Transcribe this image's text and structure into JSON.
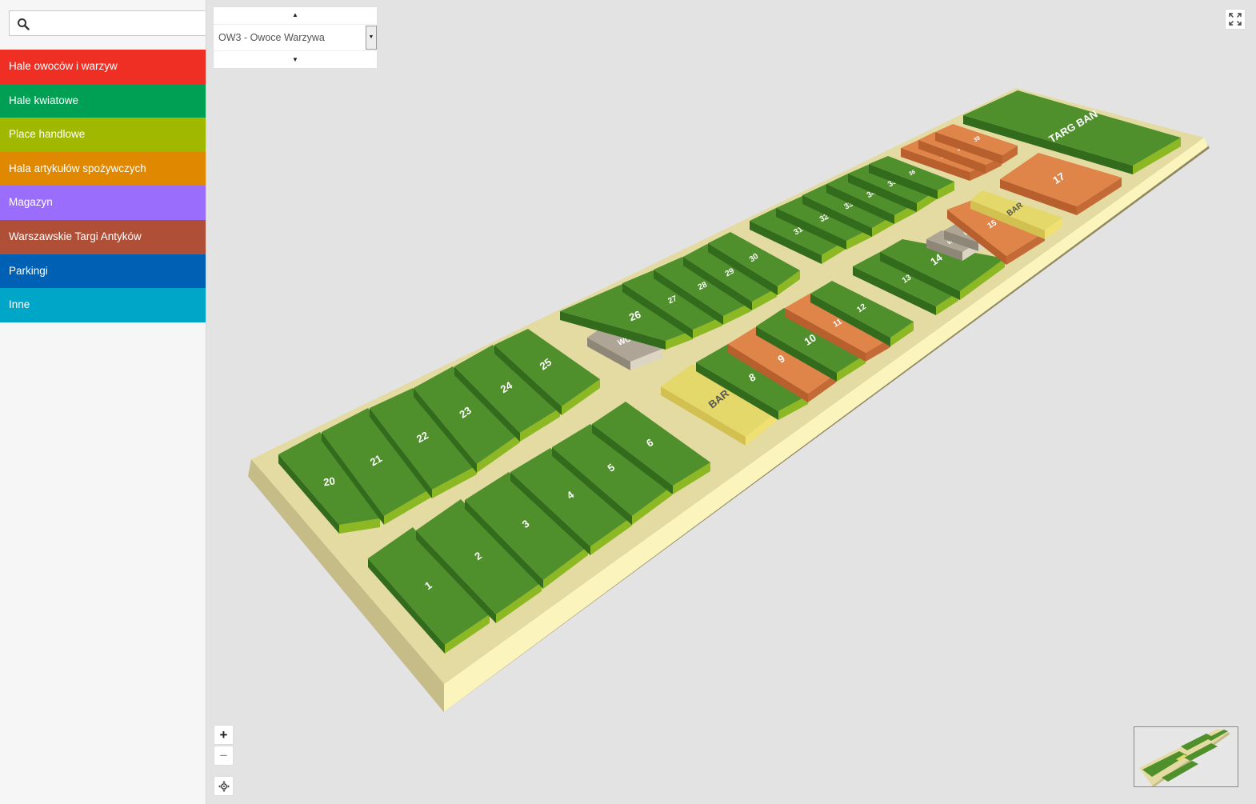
{
  "sidebar": {
    "search": {
      "value": "",
      "placeholder": ""
    },
    "categories": [
      {
        "label": "Hale owoców i warzyw",
        "color": "#ef2e24"
      },
      {
        "label": "Hale kwiatowe",
        "color": "#00a054"
      },
      {
        "label": "Place handlowe",
        "color": "#a0b800"
      },
      {
        "label": "Hala artykułów spożywczych",
        "color": "#e08800"
      },
      {
        "label": "Magazyn",
        "color": "#9b6dfc"
      },
      {
        "label": "Warszawskie Targi Antyków",
        "color": "#b04f38"
      },
      {
        "label": "Parkingi",
        "color": "#0060b4"
      },
      {
        "label": "Inne",
        "color": "#00a6c8"
      }
    ]
  },
  "selector": {
    "value": "OW3 - Owoce Warzywa"
  },
  "controls": {
    "zoom_in": "+",
    "zoom_out": "−"
  },
  "map": {
    "colors": {
      "stall": "#4f8f2c",
      "stall_side": "#8cb823",
      "stall_dark": "#336b1d",
      "orange": "#e0854a",
      "yellow": "#e4d86a",
      "wc": "#aea596",
      "platform": "#e3dba2",
      "platform_front": "#fbf4bc",
      "platform_left": "#c5bc88"
    },
    "stalls": [
      {
        "id": "1",
        "label": "1",
        "kind": "green"
      },
      {
        "id": "2",
        "label": "2",
        "kind": "green"
      },
      {
        "id": "3",
        "label": "3",
        "kind": "green"
      },
      {
        "id": "4",
        "label": "4",
        "kind": "green"
      },
      {
        "id": "5",
        "label": "5",
        "kind": "green"
      },
      {
        "id": "6",
        "label": "6",
        "kind": "green"
      },
      {
        "id": "20",
        "label": "20",
        "kind": "green"
      },
      {
        "id": "21",
        "label": "21",
        "kind": "green"
      },
      {
        "id": "22",
        "label": "22",
        "kind": "green"
      },
      {
        "id": "23",
        "label": "23",
        "kind": "green"
      },
      {
        "id": "24",
        "label": "24",
        "kind": "green"
      },
      {
        "id": "25",
        "label": "25",
        "kind": "green"
      },
      {
        "id": "bar1",
        "label": "BAR",
        "kind": "yellow"
      },
      {
        "id": "8",
        "label": "8",
        "kind": "green"
      },
      {
        "id": "9",
        "label": "9",
        "kind": "orange"
      },
      {
        "id": "10",
        "label": "10",
        "kind": "green"
      },
      {
        "id": "11",
        "label": "11",
        "kind": "orange"
      },
      {
        "id": "12",
        "label": "12",
        "kind": "green"
      },
      {
        "id": "wc1",
        "label": "WC",
        "kind": "wc"
      },
      {
        "id": "26",
        "label": "26",
        "kind": "green"
      },
      {
        "id": "27",
        "label": "27",
        "kind": "green"
      },
      {
        "id": "28",
        "label": "28",
        "kind": "green"
      },
      {
        "id": "29",
        "label": "29",
        "kind": "green"
      },
      {
        "id": "30",
        "label": "30",
        "kind": "green"
      },
      {
        "id": "13",
        "label": "13",
        "kind": "green"
      },
      {
        "id": "14",
        "label": "14",
        "kind": "green"
      },
      {
        "id": "wc2",
        "label": "WC",
        "kind": "wc"
      },
      {
        "id": "wc3",
        "label": "WC",
        "kind": "wc"
      },
      {
        "id": "15",
        "label": "15",
        "kind": "orange"
      },
      {
        "id": "bar2",
        "label": "BAR",
        "kind": "yellow"
      },
      {
        "id": "31",
        "label": "31",
        "kind": "green"
      },
      {
        "id": "32",
        "label": "32",
        "kind": "green"
      },
      {
        "id": "33",
        "label": "33",
        "kind": "green"
      },
      {
        "id": "34",
        "label": "34",
        "kind": "green"
      },
      {
        "id": "35",
        "label": "35",
        "kind": "green"
      },
      {
        "id": "36",
        "label": "36",
        "kind": "green"
      },
      {
        "id": "37",
        "label": "37",
        "kind": "orange"
      },
      {
        "id": "38",
        "label": "38",
        "kind": "orange"
      },
      {
        "id": "39",
        "label": "39",
        "kind": "orange"
      },
      {
        "id": "17",
        "label": "17",
        "kind": "orange"
      },
      {
        "id": "targ",
        "label": "TARG BAN",
        "kind": "green"
      }
    ]
  }
}
